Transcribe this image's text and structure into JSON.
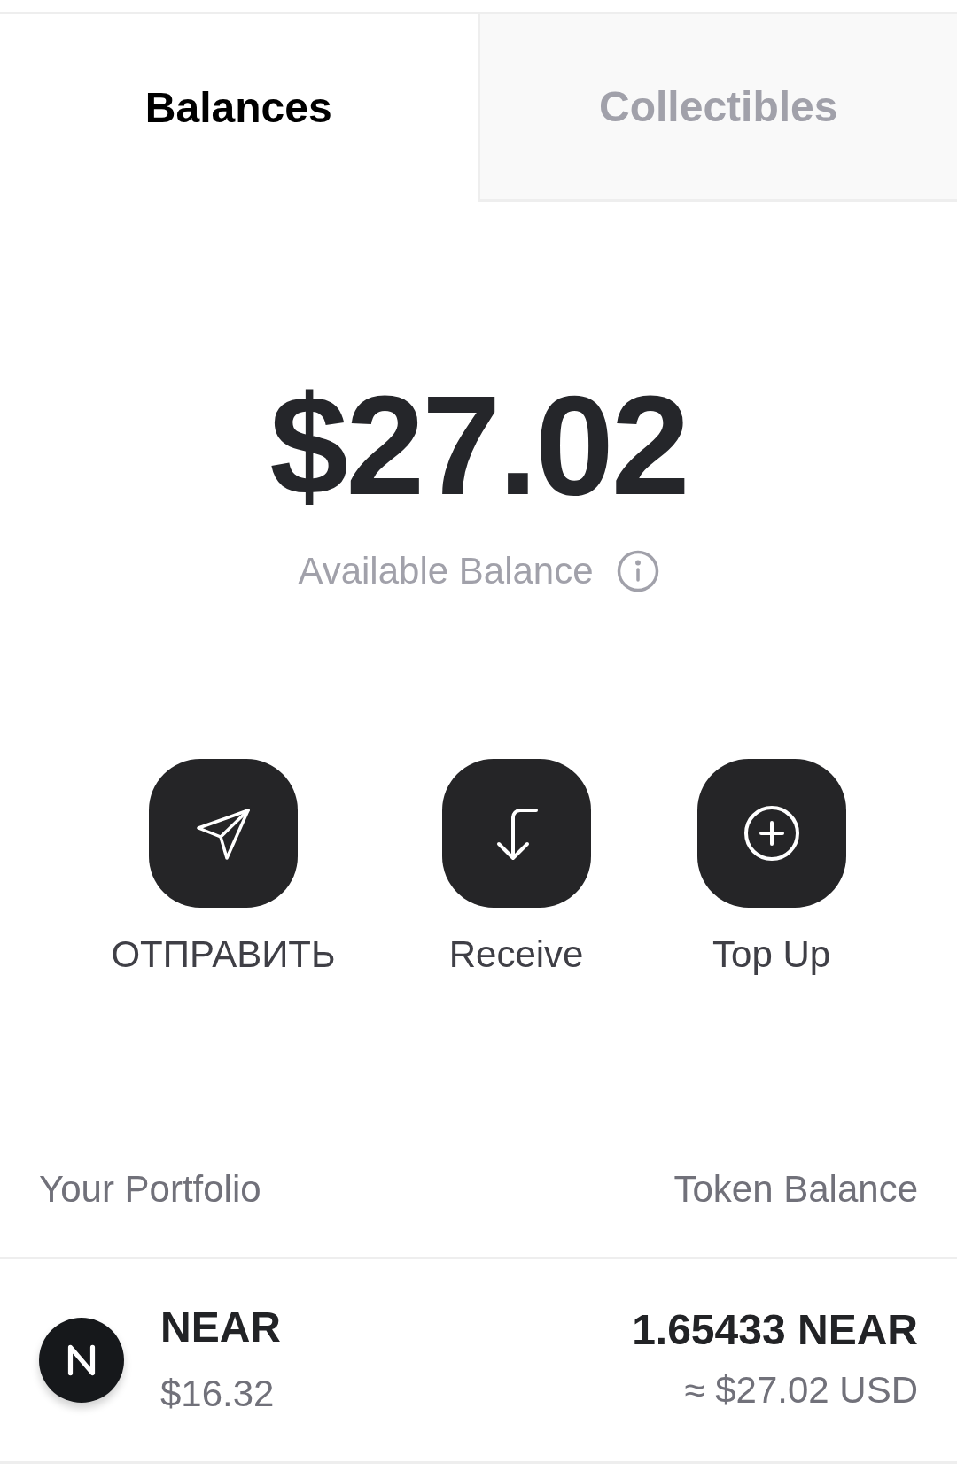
{
  "tabs": [
    {
      "label": "Balances",
      "selected": true
    },
    {
      "label": "Collectibles",
      "selected": false
    }
  ],
  "balance": {
    "amount": "$27.02",
    "label": "Available Balance"
  },
  "actions": [
    {
      "kind": "send",
      "label": "ОТПРАВИТЬ"
    },
    {
      "kind": "receive",
      "label": "Receive"
    },
    {
      "kind": "top_up",
      "label": "Top Up"
    }
  ],
  "portfolio": {
    "columns": [
      "Your Portfolio",
      "Token Balance"
    ],
    "tokens": [
      {
        "symbol": "NEAR",
        "price": "$16.32",
        "amount": "1.65433 NEAR",
        "value": "≈ $27.02 USD"
      }
    ]
  }
}
